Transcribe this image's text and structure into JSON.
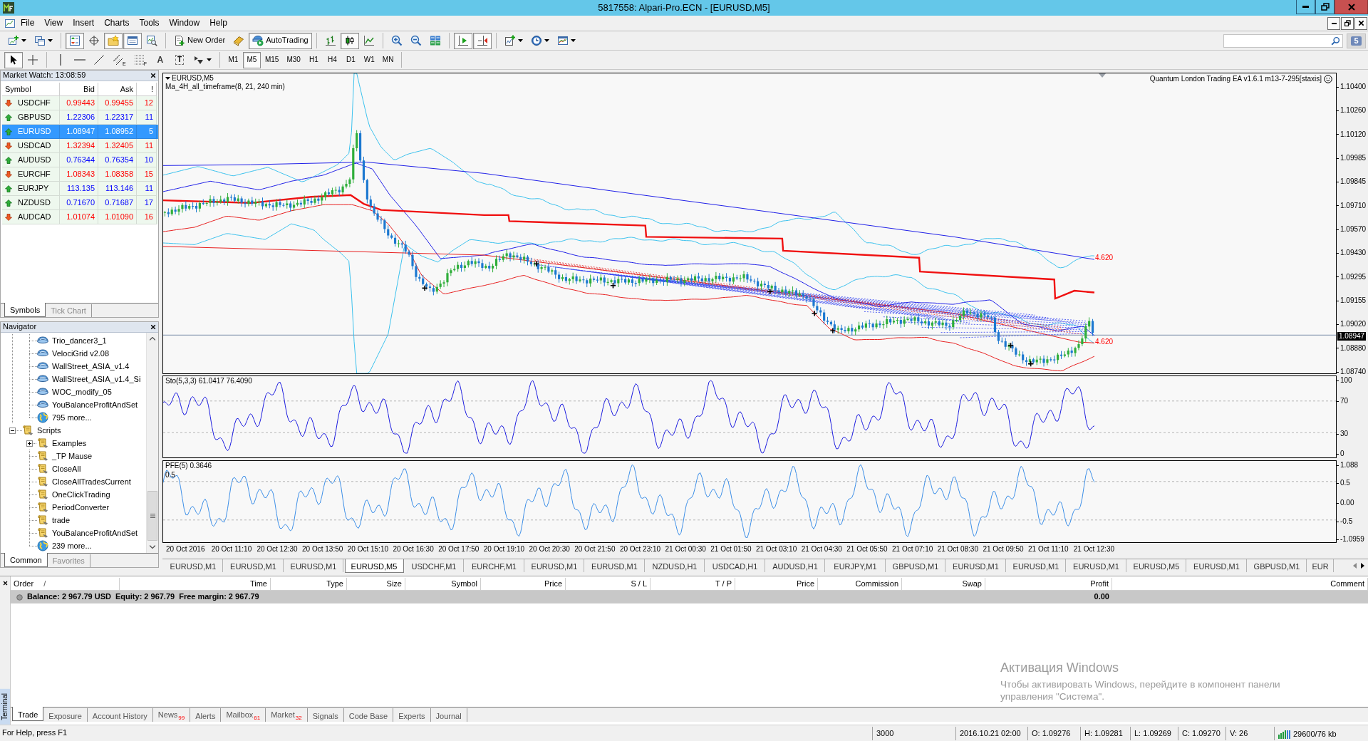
{
  "window": {
    "title": "5817558: Alpari-Pro.ECN - [EURUSD,M5]"
  },
  "menu": [
    "File",
    "View",
    "Insert",
    "Charts",
    "Tools",
    "Window",
    "Help"
  ],
  "toolbar": {
    "groups": [
      [
        {
          "kind": "new-chart",
          "dropdown": true
        },
        {
          "kind": "profiles",
          "dropdown": true
        }
      ],
      [
        {
          "kind": "market-watch",
          "on": true
        },
        {
          "kind": "data-window",
          "on": false
        },
        {
          "kind": "navigator",
          "on": true
        },
        {
          "kind": "terminal",
          "on": true
        },
        {
          "kind": "tester",
          "on": false
        }
      ],
      [
        {
          "kind": "new-order",
          "label": "New Order"
        },
        {
          "kind": "editor"
        },
        {
          "kind": "autotrading",
          "label": "AutoTrading",
          "on": true
        }
      ],
      [
        {
          "kind": "bars",
          "on": false
        },
        {
          "kind": "candles",
          "on": true
        },
        {
          "kind": "line",
          "on": false
        }
      ],
      [
        {
          "kind": "zoom-in"
        },
        {
          "kind": "zoom-out"
        },
        {
          "kind": "tile"
        }
      ],
      [
        {
          "kind": "autoscroll",
          "on": true
        },
        {
          "kind": "shift",
          "on": true
        }
      ],
      [
        {
          "kind": "indicators",
          "dropdown": true
        },
        {
          "kind": "periods",
          "dropdown": true
        },
        {
          "kind": "templates",
          "dropdown": true
        }
      ]
    ],
    "messages": "5"
  },
  "drawing_bar": {
    "groups": [
      [
        {
          "kind": "cursor",
          "on": true
        },
        {
          "kind": "crosshair",
          "on": false
        }
      ],
      [
        {
          "kind": "vertical-line"
        },
        {
          "kind": "horizontal-line"
        },
        {
          "kind": "trendline"
        },
        {
          "kind": "channel",
          "glyph": "E"
        },
        {
          "kind": "fibonacci",
          "glyph": "F"
        },
        {
          "kind": "text",
          "glyph": "A"
        },
        {
          "kind": "label",
          "glyph": "T"
        },
        {
          "kind": "arrows",
          "dropdown": true
        }
      ]
    ],
    "timeframes": [
      {
        "label": "M1",
        "selected": false
      },
      {
        "label": "M5",
        "selected": true
      },
      {
        "label": "M15",
        "selected": false
      },
      {
        "label": "M30",
        "selected": false
      },
      {
        "label": "H1",
        "selected": false
      },
      {
        "label": "H4",
        "selected": false
      },
      {
        "label": "D1",
        "selected": false
      },
      {
        "label": "W1",
        "selected": false
      },
      {
        "label": "MN",
        "selected": false
      }
    ]
  },
  "market_watch": {
    "title": "Market Watch: 13:08:59",
    "columns": [
      "Symbol",
      "Bid",
      "Ask",
      "!"
    ],
    "rows": [
      {
        "symbol": "USDCHF",
        "bid": "0.99443",
        "ask": "0.99455",
        "spread": "12",
        "rising": false,
        "selected": false
      },
      {
        "symbol": "GBPUSD",
        "bid": "1.22306",
        "ask": "1.22317",
        "spread": "11",
        "rising": true,
        "selected": false
      },
      {
        "symbol": "EURUSD",
        "bid": "1.08947",
        "ask": "1.08952",
        "spread": "5",
        "rising": true,
        "selected": true
      },
      {
        "symbol": "USDCAD",
        "bid": "1.32394",
        "ask": "1.32405",
        "spread": "11",
        "rising": false,
        "selected": false
      },
      {
        "symbol": "AUDUSD",
        "bid": "0.76344",
        "ask": "0.76354",
        "spread": "10",
        "rising": true,
        "selected": false
      },
      {
        "symbol": "EURCHF",
        "bid": "1.08343",
        "ask": "1.08358",
        "spread": "15",
        "rising": false,
        "selected": false
      },
      {
        "symbol": "EURJPY",
        "bid": "113.135",
        "ask": "113.146",
        "spread": "11",
        "rising": true,
        "selected": false
      },
      {
        "symbol": "NZDUSD",
        "bid": "0.71670",
        "ask": "0.71687",
        "spread": "17",
        "rising": true,
        "selected": false
      },
      {
        "symbol": "AUDCAD",
        "bid": "1.01074",
        "ask": "1.01090",
        "spread": "16",
        "rising": false,
        "selected": false
      }
    ],
    "tabs": [
      {
        "label": "Symbols",
        "selected": true
      },
      {
        "label": "Tick Chart",
        "selected": false
      }
    ]
  },
  "navigator": {
    "title": "Navigator",
    "items": [
      {
        "children": [
          {
            "label": "Trio_dancer3_1",
            "kind": "expert"
          },
          {
            "label": "VelociGrid v2.08",
            "kind": "expert"
          },
          {
            "label": "WallStreet_ASIA_v1.4",
            "kind": "expert"
          },
          {
            "label": "WallStreet_ASIA_v1.4_Si",
            "kind": "expert"
          },
          {
            "label": "WOC_modify_05",
            "kind": "expert"
          },
          {
            "label": "YouBalanceProfitAndSet",
            "kind": "expert"
          },
          {
            "label": "795 more...",
            "kind": "more"
          }
        ]
      },
      {
        "label": "Scripts",
        "kind": "folder",
        "expanded": true,
        "children": [
          {
            "label": "Examples",
            "kind": "folder",
            "expanded": false
          },
          {
            "label": "_TP Mause",
            "kind": "script"
          },
          {
            "label": "CloseAll",
            "kind": "script"
          },
          {
            "label": "CloseAllTradesCurrent",
            "kind": "script"
          },
          {
            "label": "OneClickTrading",
            "kind": "script"
          },
          {
            "label": "PeriodConverter",
            "kind": "script"
          },
          {
            "label": "trade",
            "kind": "script"
          },
          {
            "label": "YouBalanceProfitAndSet",
            "kind": "script"
          },
          {
            "label": "239 more...",
            "kind": "more"
          }
        ]
      }
    ],
    "tabs": [
      {
        "label": "Common",
        "selected": true
      },
      {
        "label": "Favorites",
        "selected": false
      }
    ]
  },
  "chart": {
    "symbol_label": "EURUSD,M5",
    "indicator_label": "Ma_4H_all_timeframe(8, 21, 240 min)",
    "expert_label": "Quantum London Trading EA v1.6.1 m13-7-295[staxis]",
    "line_labels": [
      "4.620",
      "4.620"
    ],
    "price_scale": [
      "1.10400",
      "1.10260",
      "1.10120",
      "1.09985",
      "1.09845",
      "1.09710",
      "1.09570",
      "1.09430",
      "1.09295",
      "1.09155",
      "1.09020",
      "1.08880",
      "1.08740"
    ],
    "current_price": "1.08947",
    "panes": [
      {
        "kind": "stochastic",
        "label": "Sto(5,3,3) 61.0417 76.4090",
        "scale": [
          "100",
          "70",
          "30",
          "0"
        ]
      },
      {
        "kind": "pfe",
        "label": "PFE(5) 0.3646",
        "level_label": "0.5",
        "scale": [
          "1.088",
          "0.5",
          "0.00",
          "-0.5",
          "-1.0959"
        ]
      }
    ],
    "time_scale": [
      "20 Oct 2016",
      "20 Oct 11:10",
      "20 Oct 12:30",
      "20 Oct 13:50",
      "20 Oct 15:10",
      "20 Oct 16:30",
      "20 Oct 17:50",
      "20 Oct 19:10",
      "20 Oct 20:30",
      "20 Oct 21:50",
      "20 Oct 23:10",
      "21 Oct 00:30",
      "21 Oct 01:50",
      "21 Oct 03:10",
      "21 Oct 04:30",
      "21 Oct 05:50",
      "21 Oct 07:10",
      "21 Oct 08:30",
      "21 Oct 09:50",
      "21 Oct 11:10",
      "21 Oct 12:30"
    ],
    "tabs": [
      {
        "label": "EURUSD,M1",
        "selected": false
      },
      {
        "label": "EURUSD,M1",
        "selected": false
      },
      {
        "label": "EURUSD,M1",
        "selected": false
      },
      {
        "label": "EURUSD,M5",
        "selected": true
      },
      {
        "label": "USDCHF,M1",
        "selected": false
      },
      {
        "label": "EURCHF,M1",
        "selected": false
      },
      {
        "label": "EURUSD,M1",
        "selected": false
      },
      {
        "label": "EURUSD,M1",
        "selected": false
      },
      {
        "label": "NZDUSD,H1",
        "selected": false
      },
      {
        "label": "USDCAD,H1",
        "selected": false
      },
      {
        "label": "AUDUSD,H1",
        "selected": false
      },
      {
        "label": "EURJPY,M1",
        "selected": false
      },
      {
        "label": "GBPUSD,M1",
        "selected": false
      },
      {
        "label": "EURUSD,M1",
        "selected": false
      },
      {
        "label": "EURUSD,M1",
        "selected": false
      },
      {
        "label": "EURUSD,M1",
        "selected": false
      },
      {
        "label": "EURUSD,M5",
        "selected": false
      },
      {
        "label": "EURUSD,M1",
        "selected": false
      },
      {
        "label": "GBPUSD,M1",
        "selected": false
      },
      {
        "label": "EUR",
        "selected": false
      }
    ]
  },
  "terminal": {
    "title": "Terminal",
    "columns": [
      "Order",
      "Time",
      "Type",
      "Size",
      "Symbol",
      "Price",
      "S / L",
      "T / P",
      "Price",
      "Commission",
      "Swap",
      "Profit",
      "Comment"
    ],
    "sort_mark": "/",
    "balance": {
      "items": [
        "Balance: 2 967.79 USD",
        "Equity: 2 967.79",
        "Free margin: 2 967.79"
      ],
      "profit": "0.00"
    },
    "tabs": [
      {
        "label": "Trade",
        "selected": true
      },
      {
        "label": "Exposure",
        "selected": false
      },
      {
        "label": "Account History",
        "selected": false
      },
      {
        "label": "News",
        "badge": "99",
        "selected": false
      },
      {
        "label": "Alerts",
        "selected": false
      },
      {
        "label": "Mailbox",
        "badge": "61",
        "selected": false
      },
      {
        "label": "Market",
        "badge": "32",
        "selected": false
      },
      {
        "label": "Signals",
        "selected": false
      },
      {
        "label": "Code Base",
        "selected": false
      },
      {
        "label": "Experts",
        "selected": false
      },
      {
        "label": "Journal",
        "selected": false
      }
    ]
  },
  "status_bar": {
    "help": "For Help, press F1",
    "cells": [
      "3000",
      "2016.10.21 02:00",
      "O: 1.09276",
      "H: 1.09281",
      "L: 1.09269",
      "C: 1.09270",
      "V: 26"
    ],
    "traffic": "29600/76 kb"
  },
  "os_notice": {
    "title": "Активация Windows",
    "text": "Чтобы активировать Windows, перейдите в компонент панели управления \"Система\"."
  }
}
